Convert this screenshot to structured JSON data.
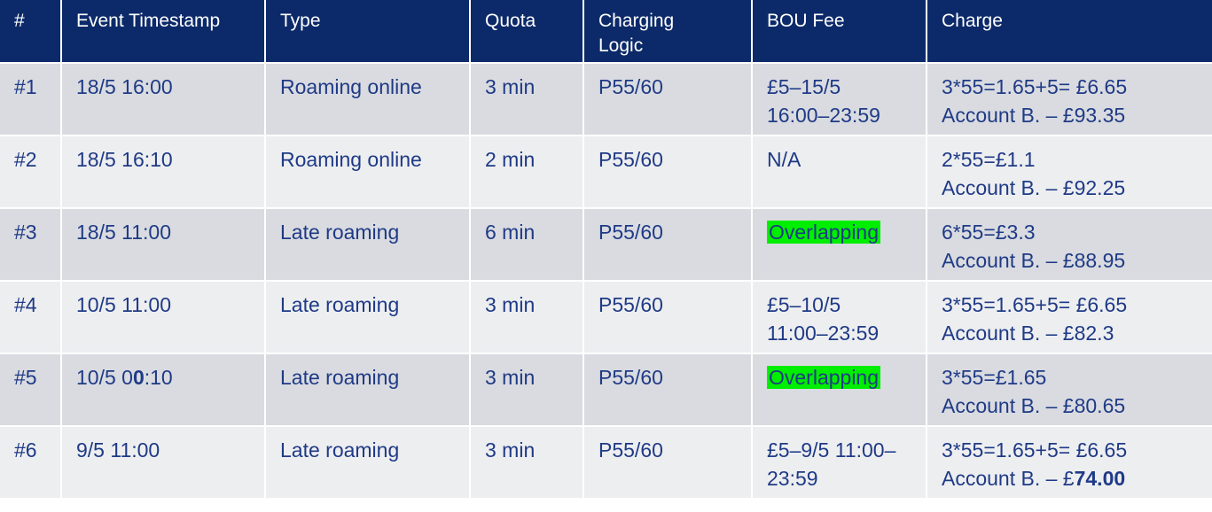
{
  "header": {
    "num": "#",
    "timestamp": "Event Timestamp",
    "type": "Type",
    "quota": "Quota",
    "logic_line1": "Charging",
    "logic_line2": "Logic",
    "fee": "BOU Fee",
    "charge": "Charge"
  },
  "rows": [
    {
      "num": "#1",
      "ts": "18/5 16:00",
      "type": "Roaming online",
      "quota": "3 min",
      "logic": "P55/60",
      "fee1": "£5–15/5",
      "fee2": "16:00–23:59",
      "charge1": "3*55=1.65+5= £6.65",
      "charge2": "Account B. – £93.35"
    },
    {
      "num": "#2",
      "ts": "18/5 16:10",
      "type": "Roaming online",
      "quota": "2 min",
      "logic": "P55/60",
      "fee1": "N/A",
      "charge1": "2*55=£1.1",
      "charge2": "Account B. – £92.25"
    },
    {
      "num": "#3",
      "ts": "18/5 11:00",
      "type": "Late roaming",
      "quota": "6 min",
      "logic": "P55/60",
      "fee_hl": "Overlapping",
      "charge1": "6*55=£3.3",
      "charge2": "Account B. – £88.95"
    },
    {
      "num": "#4",
      "ts": "10/5 11:00",
      "type": "Late roaming",
      "quota": "3 min",
      "logic": "P55/60",
      "fee1": "£5–10/5",
      "fee2": "11:00–23:59",
      "charge1": "3*55=1.65+5= £6.65",
      "charge2": "Account B. – £82.3"
    },
    {
      "num": "#5",
      "ts_a": "10/5 0",
      "ts_b": "0",
      "ts_c": ":10",
      "type": "Late roaming",
      "quota": "3 min",
      "logic": "P55/60",
      "fee_hl": "Overlapping",
      "charge1": "3*55=£1.65",
      "charge2": "Account B. – £80.65"
    },
    {
      "num": "#6",
      "ts": "9/5 11:00",
      "type": "Late roaming",
      "quota": "3 min",
      "logic": "P55/60",
      "fee1": "£5–9/5 11:00–",
      "fee2": "23:59",
      "charge1": "3*55=1.65+5= £6.65",
      "charge2a": "Account B. – £",
      "charge2b": "74.00"
    }
  ],
  "colors": {
    "header_bg": "#0c2a69",
    "row_odd": "#d9dbe0",
    "row_even": "#edeef0",
    "text": "#1f3a86",
    "highlight": "#00ee00"
  }
}
